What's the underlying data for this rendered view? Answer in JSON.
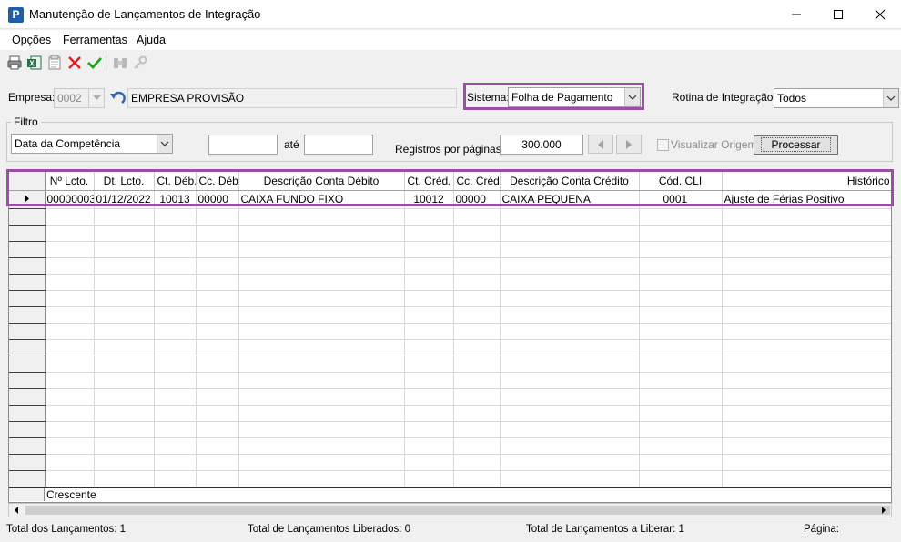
{
  "window": {
    "title": "Manutenção de Lançamentos de Integração",
    "app_icon_letter": "P",
    "icon": "app-icon"
  },
  "menu": {
    "items": [
      {
        "label": "Opções"
      },
      {
        "label": "Ferramentas"
      },
      {
        "label": "Ajuda"
      }
    ]
  },
  "toolbar": {
    "icons": [
      "print-icon",
      "excel-export-icon",
      "notes-icon",
      "delete-icon",
      "confirm-icon",
      "binoculars-icon",
      "key-icon"
    ]
  },
  "empresa": {
    "label": "Empresa:",
    "code": "0002",
    "name": "EMPRESA PROVISÃO"
  },
  "sistema": {
    "label": "Sistema:",
    "value": "Folha de Pagamento"
  },
  "rotina": {
    "label": "Rotina de Integração:",
    "value": "Todos"
  },
  "filtro": {
    "group_label": "Filtro",
    "date_type": "Data da Competência",
    "date_from": "",
    "until_label": "até",
    "date_to": "",
    "records_label": "Registros por páginas:",
    "records_value": "300.000",
    "visualizar_label": "Visualizar Origem",
    "visualizar_checked": false,
    "process_label": "Processar"
  },
  "grid": {
    "columns": [
      {
        "label": "Nº Lcto."
      },
      {
        "label": "Dt. Lcto."
      },
      {
        "label": "Ct. Déb."
      },
      {
        "label": "Cc. Déb."
      },
      {
        "label": "Descrição Conta Débito"
      },
      {
        "label": "Ct. Créd."
      },
      {
        "label": "Cc. Créd."
      },
      {
        "label": "Descrição Conta Crédito"
      },
      {
        "label": "Cód. CLI"
      },
      {
        "label": "Histórico"
      }
    ],
    "rows": [
      [
        "00000003",
        "01/12/2022",
        "10013",
        "00000",
        "CAIXA FUNDO FIXO",
        "10012",
        "00000",
        "CAIXA PEQUENA",
        "0001",
        "Ajuste de Férias Positivo"
      ]
    ],
    "footer": "Crescente"
  },
  "status": {
    "total_lancamentos": "Total dos Lançamentos: 1",
    "total_liberados": "Total de Lançamentos Liberados: 0",
    "total_a_liberar": "Total de Lançamentos a Liberar: 1",
    "pagina": "Página:"
  },
  "colors": {
    "highlight": "#9b4ea6",
    "app_icon": "#1f5fa8"
  }
}
